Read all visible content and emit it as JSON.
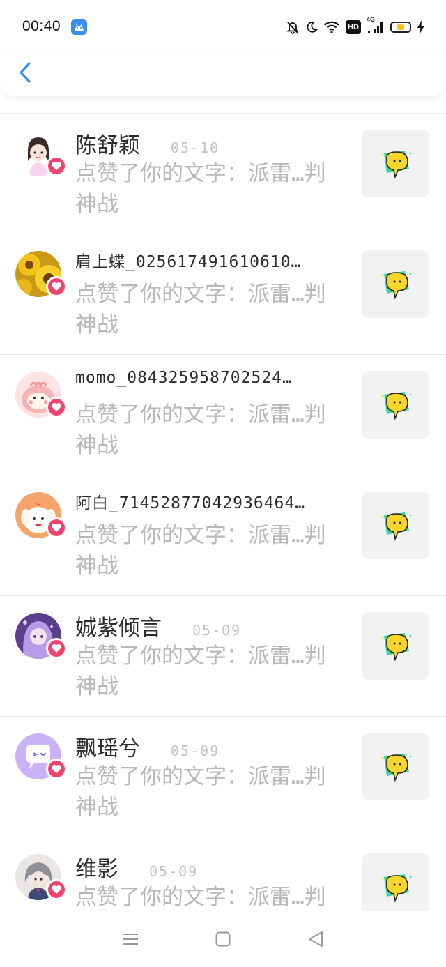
{
  "status_bar": {
    "time": "00:40",
    "hd_label": "HD",
    "network_label": "4G",
    "battery_color": "#f3c623",
    "icons": [
      "app-badge-icon",
      "mute-bell-icon",
      "moon-icon",
      "wifi-icon",
      "hd-icon",
      "signal-icon",
      "battery-icon",
      "charging-icon"
    ]
  },
  "header": {
    "back_icon": "chevron-left-icon",
    "accent": "#3a8ef0"
  },
  "notifications": [
    {
      "name": "陈舒颖",
      "date": "05-10",
      "desc": "点赞了你的文字：派雷…判神战",
      "avatar": "girl-avatar"
    },
    {
      "name": "肩上蝶_025617491610610…",
      "date": "",
      "desc": "点赞了你的文字：派雷…判神战",
      "avatar": "sunflower-avatar"
    },
    {
      "name": "momo_084325958702524…",
      "date": "",
      "desc": "点赞了你的文字：派雷…判神战",
      "avatar": "pink-creature-avatar"
    },
    {
      "name": "阿白_71452877042936464…",
      "date": "",
      "desc": "点赞了你的文字：派雷…判神战",
      "avatar": "dog-avatar"
    },
    {
      "name": "娍紫倾言",
      "date": "05-09",
      "desc": "点赞了你的文字：派雷…判神战",
      "avatar": "purple-anime-avatar"
    },
    {
      "name": "飘瑶兮",
      "date": "05-09",
      "desc": "点赞了你的文字：派雷…判神战",
      "avatar": "purple-bubble-avatar"
    },
    {
      "name": "维影",
      "date": "05-09",
      "desc": "点赞了你的文字：派雷…判神战",
      "avatar": "anime-boy-avatar"
    }
  ],
  "like_color": "#f0446e",
  "thumbnail_icon": "yellow-chat-bubble-icon",
  "nav": {
    "icons": [
      "menu-icon",
      "home-square-icon",
      "back-triangle-icon"
    ]
  }
}
